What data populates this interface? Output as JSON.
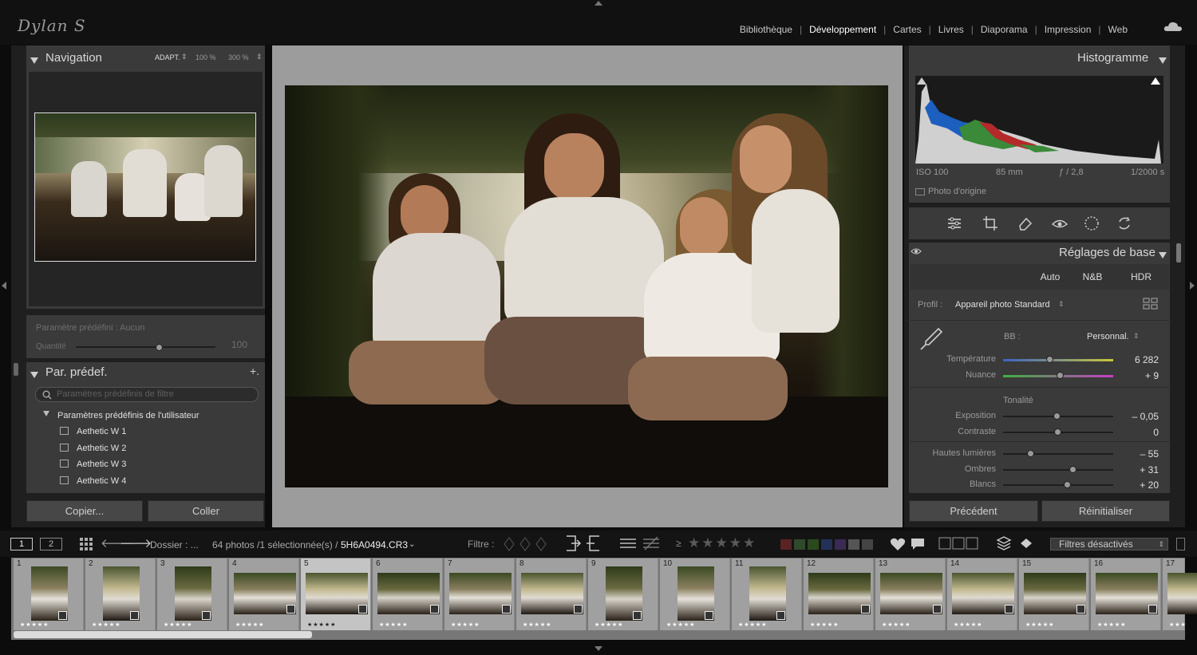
{
  "app": {
    "logo": "Dylan S"
  },
  "modules": [
    {
      "label": "Bibliothèque"
    },
    {
      "label": "Développement",
      "active": true
    },
    {
      "label": "Cartes"
    },
    {
      "label": "Livres"
    },
    {
      "label": "Diaporama"
    },
    {
      "label": "Impression"
    },
    {
      "label": "Web"
    }
  ],
  "navigator": {
    "title": "Navigation",
    "zoom_fit": "ADAPT.",
    "zoom_100": "100 %",
    "zoom_300": "300 %"
  },
  "preset_amount": {
    "label": "Paramètre prédéfini : Aucun",
    "amount_label": "Quantité",
    "amount_value": "100",
    "amount_fraction": 0.6
  },
  "presets": {
    "title": "Par. prédef.",
    "add": "+.",
    "search_placeholder": "Paramètres prédéfinis de filtre",
    "group": "Paramètres prédéfinis de l'utilisateur",
    "items": [
      "Aethetic W 1",
      "Aethetic W 2",
      "Aethetic W 3",
      "Aethetic W 4"
    ]
  },
  "left_buttons": {
    "copy": "Copier...",
    "paste": "Coller"
  },
  "histogram": {
    "title": "Histogramme",
    "iso": "ISO 100",
    "focal": "85 mm",
    "aperture": "ƒ / 2,8",
    "shutter": "1/2000 s",
    "original_label": "Photo d'origine"
  },
  "tools": [
    "sliders-icon",
    "crop-icon",
    "heal-icon",
    "redeye-icon",
    "mask-icon",
    "reset-icon"
  ],
  "basic": {
    "title": "Réglages de base",
    "btn_auto": "Auto",
    "btn_bw": "N&B",
    "btn_hdr": "HDR",
    "profile_label": "Profil :",
    "profile_value": "Appareil photo Standard",
    "wb_label": "BB :",
    "wb_value": "Personnal.",
    "temp_label": "Température",
    "temp_value": "6 282",
    "temp_pos": 0.43,
    "tint_label": "Nuance",
    "tint_value": "+ 9",
    "tint_pos": 0.52,
    "tone_title": "Tonalité",
    "exposure_label": "Exposition",
    "exposure_value": "– 0,05",
    "exposure_pos": 0.49,
    "contrast_label": "Contraste",
    "contrast_value": "0",
    "contrast_pos": 0.5,
    "highlights_label": "Hautes lumières",
    "highlights_value": "– 55",
    "highlights_pos": 0.25,
    "shadows_label": "Ombres",
    "shadows_value": "+ 31",
    "shadows_pos": 0.64,
    "whites_label": "Blancs",
    "whites_value": "+ 20",
    "whites_pos": 0.59
  },
  "right_buttons": {
    "previous": "Précédent",
    "reset": "Réinitialiser"
  },
  "toolbar": {
    "page1": "1",
    "page2": "2",
    "folder": "Dossier : ...",
    "count": "64 photos /1 sélectionnée(s) /",
    "filename": "5H6A0494.CR3",
    "filter_label": "Filtre :",
    "filters_off": "Filtres désactivés",
    "gte": "≥",
    "stars": "★★★★★"
  },
  "colors": {
    "labels": [
      "#5a2323",
      "#2f4a2a",
      "#2a4a1d",
      "#233058",
      "#3a2a55",
      "#555555",
      "#444444"
    ]
  },
  "filmstrip": [
    {
      "num": "1",
      "stars": "★★★★★"
    },
    {
      "num": "2",
      "stars": "★★★★★"
    },
    {
      "num": "3",
      "stars": "★★★★★"
    },
    {
      "num": "4",
      "stars": "★★★★★"
    },
    {
      "num": "5",
      "stars": "★★★★★"
    },
    {
      "num": "6",
      "stars": "★★★★★"
    },
    {
      "num": "7",
      "stars": "★★★★★"
    },
    {
      "num": "8",
      "stars": "★★★★★"
    },
    {
      "num": "9",
      "stars": "★★★★★"
    },
    {
      "num": "10",
      "stars": "★★★★★"
    },
    {
      "num": "11",
      "stars": "★★★★★"
    },
    {
      "num": "12",
      "stars": "★★★★★"
    },
    {
      "num": "13",
      "stars": "★★★★★"
    },
    {
      "num": "14",
      "stars": "★★★★★"
    },
    {
      "num": "15",
      "stars": "★★★★★"
    },
    {
      "num": "16",
      "stars": "★★★★★"
    },
    {
      "num": "17",
      "stars": "★★★"
    }
  ]
}
